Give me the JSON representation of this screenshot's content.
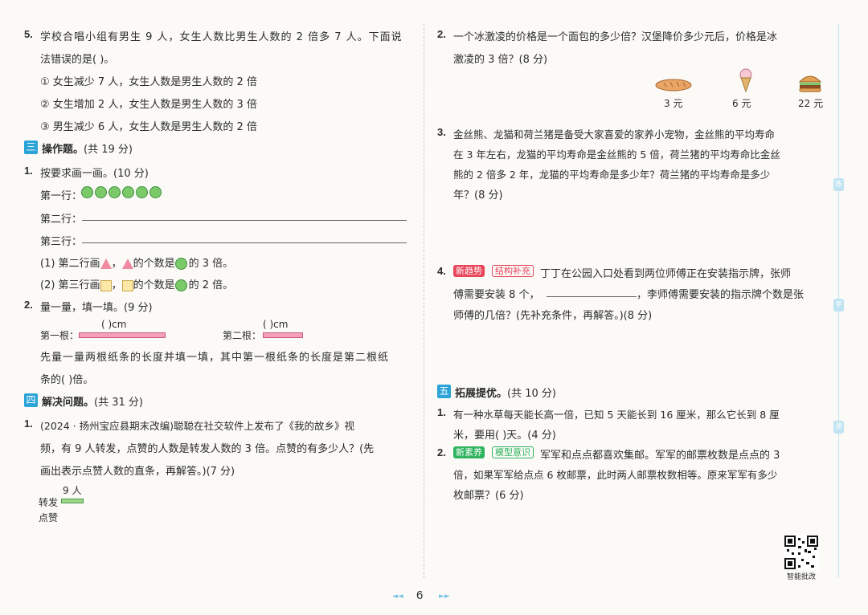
{
  "left": {
    "q5": {
      "num": "5.",
      "line1": "学校合唱小组有男生 9 人，女生人数比男生人数的 2 倍多 7 人。下面说",
      "line2": "法错误的是(      )。",
      "opt1": "① 女生减少 7 人，女生人数是男生人数的 2 倍",
      "opt2": "② 女生增加 2 人，女生人数是男生人数的 3 倍",
      "opt3": "③ 男生减少 6 人，女生人数是男生人数的 2 倍"
    },
    "sec3": {
      "badge": "三",
      "title": "操作题。",
      "score": "(共 19 分)"
    },
    "q1": {
      "num": "1.",
      "text": "按要求画一画。(10 分)",
      "row1": "第一行：",
      "circle_count": 6,
      "row2": "第二行：",
      "row3": "第三行：",
      "inst1_a": "(1) 第二行画",
      "inst1_b": "，",
      "inst1_c": "的个数是",
      "inst1_d": "的 3 倍。",
      "inst2_a": "(2) 第三行画",
      "inst2_b": "，",
      "inst2_c": "的个数是",
      "inst2_d": "的 2 倍。"
    },
    "q2": {
      "num": "2.",
      "text": "量一量，填一填。(9 分)",
      "strip1_label": "第一根：",
      "strip1_unit": "(     )cm",
      "strip2_label": "第二根：",
      "strip2_unit": "(     )cm",
      "line1": "先量一量两根纸条的长度并填一填，其中第一根纸条的长度是第二根纸",
      "line2": "条的(      )倍。"
    },
    "sec4": {
      "badge": "四",
      "title": "解决问题。",
      "score": "(共 31 分)"
    },
    "p1": {
      "num": "1.",
      "line1": "(2024 · 扬州宝应县期末改编)聪聪在社交软件上发布了《我的故乡》视",
      "line2": "频，有 9 人转发，点赞的人数是转发人数的 3 倍。点赞的有多少人？(先",
      "line3": "画出表示点赞人数的直条，再解答。)(7 分)",
      "bar_value": "9 人",
      "label_forward": "转发",
      "label_like": "点赞"
    }
  },
  "right": {
    "p2": {
      "num": "2.",
      "line1": "一个冰激凌的价格是一个面包的多少倍？汉堡降价多少元后，价格是冰",
      "line2": "激凌的 3 倍？(8 分)",
      "prices": [
        "3 元",
        "6 元",
        "22 元"
      ]
    },
    "p3": {
      "num": "3.",
      "line1": "金丝熊、龙猫和荷兰猪是备受大家喜爱的家养小宠物，金丝熊的平均寿命",
      "line2": "在 3 年左右，龙猫的平均寿命是金丝熊的 5 倍，荷兰猪的平均寿命比金丝",
      "line3": "熊的 2 倍多 2 年，龙猫的平均寿命是多少年？荷兰猪的平均寿命是多少",
      "line4": "年？(8 分)"
    },
    "p4": {
      "num": "4.",
      "tag1": "新趋势",
      "tag2": "结构补充",
      "line1": "丁丁在公园入口处看到两位师傅正在安装指示牌，张师",
      "line2a": "傅需要安装 8 个，",
      "line2b": "，李师傅需要安装的指示牌个数是张",
      "line3": "师傅的几倍？(先补充条件，再解答。)(8 分)"
    },
    "sec5": {
      "badge": "五",
      "title": "拓展提优。",
      "score": "(共 10 分)"
    },
    "e1": {
      "num": "1.",
      "line1": "有一种水草每天能长高一倍，已知 5 天能长到 16 厘米，那么它长到 8 厘",
      "line2": "米，要用(      )天。(4 分)"
    },
    "e2": {
      "num": "2.",
      "tag1": "新素养",
      "tag2": "模型意识",
      "line1": "军军和点点都喜欢集邮。军军的邮票枚数是点点的 3",
      "line2": "倍，如果军军给点点 6 枚邮票，此时两人邮票枚数相等。原来军军有多少",
      "line3": "枚邮票？(6 分)"
    },
    "qr_label": "智能批改",
    "side_tabs": [
      "练",
      "学",
      "测"
    ]
  },
  "footer": {
    "page_number": "6",
    "prev": "◄◄",
    "next": "►►"
  }
}
